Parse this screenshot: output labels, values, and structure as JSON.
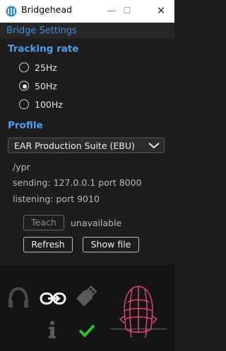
{
  "window": {
    "title": "Bridgehead",
    "minimize_glyph": "—",
    "maximize_glyph": "☐",
    "close_glyph": "✕"
  },
  "settings_header": "Bridge Settings",
  "tracking": {
    "title": "Tracking rate",
    "options": [
      {
        "label": "25Hz",
        "selected": false
      },
      {
        "label": "50Hz",
        "selected": true
      },
      {
        "label": "100Hz",
        "selected": false
      }
    ]
  },
  "profile": {
    "title": "Profile",
    "selected": "EAR Production Suite (EBU)"
  },
  "info": {
    "path": "/ypr",
    "sending": "sending: 127.0.0.1 port 8000",
    "listening": "listening: port 9010"
  },
  "buttons": {
    "teach": "Teach",
    "teach_status": "unavailable",
    "refresh": "Refresh",
    "show_file": "Show file"
  },
  "status_icons": {
    "headphones": "headphones-icon",
    "link": "link-icon",
    "usb": "usb-icon",
    "info": "info-icon",
    "check": "check-icon",
    "head": "head-wireframe-icon"
  },
  "colors": {
    "accent": "#4c9fec",
    "check": "#2ec02e",
    "head": "#e0446e"
  }
}
